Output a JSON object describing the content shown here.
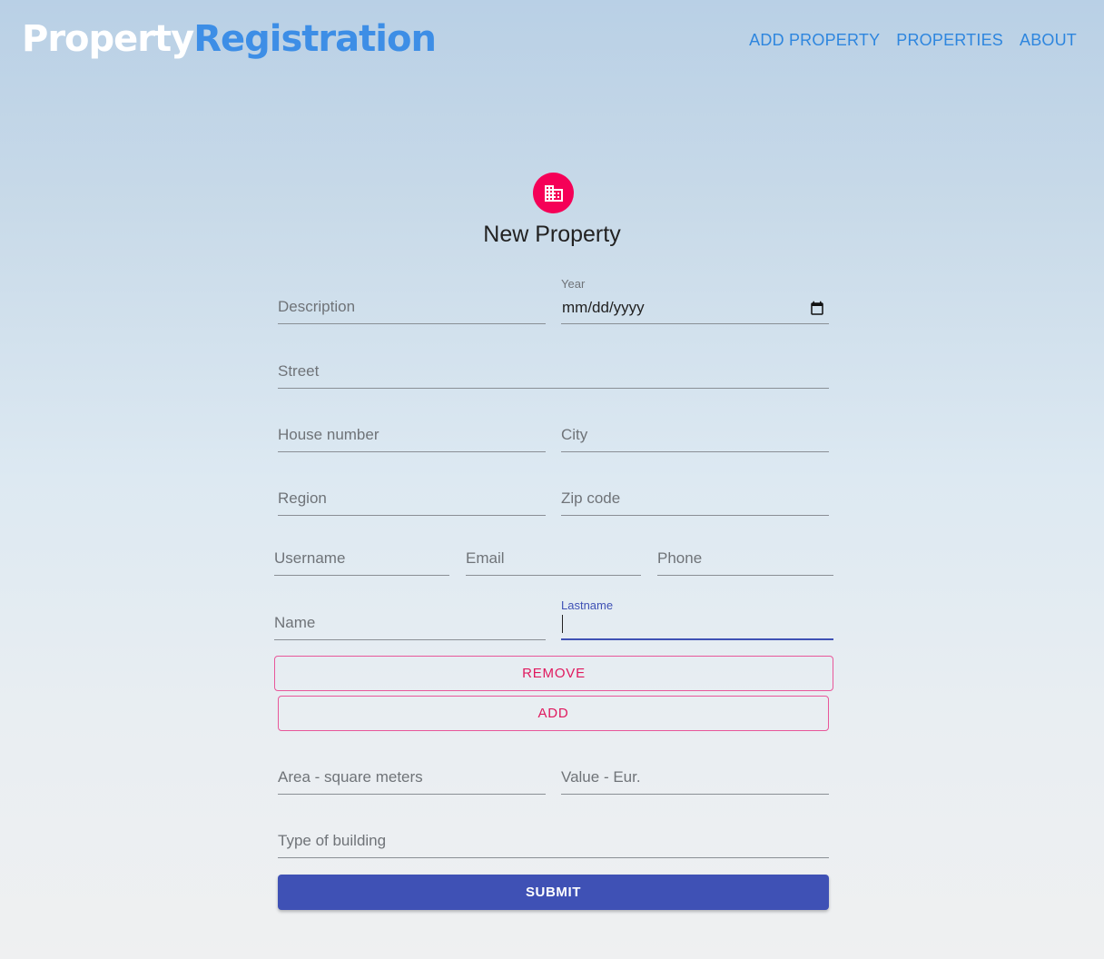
{
  "brand": {
    "part1": "Property",
    "part2": "Registration"
  },
  "nav": {
    "add_property": "ADD PROPERTY",
    "properties": "PROPERTIES",
    "about": "ABOUT"
  },
  "form": {
    "title": "New Property",
    "icon": "building-icon",
    "description_placeholder": "Description",
    "year_label": "Year",
    "year_value": "mm/dd/yyyy",
    "street_placeholder": "Street",
    "house_number_placeholder": "House number",
    "city_placeholder": "City",
    "region_placeholder": "Region",
    "zip_placeholder": "Zip code",
    "username_placeholder": "Username",
    "email_placeholder": "Email",
    "phone_placeholder": "Phone",
    "name_placeholder": "Name",
    "lastname_label": "Lastname",
    "lastname_value": "",
    "remove_label": "REMOVE",
    "add_label": "ADD",
    "area_placeholder": "Area - square meters",
    "value_placeholder": "Value - Eur.",
    "building_type_placeholder": "Type of building",
    "submit_label": "SUBMIT"
  },
  "colors": {
    "accent": "#3f51b5",
    "secondary": "#f50057",
    "link": "#2e86de"
  }
}
